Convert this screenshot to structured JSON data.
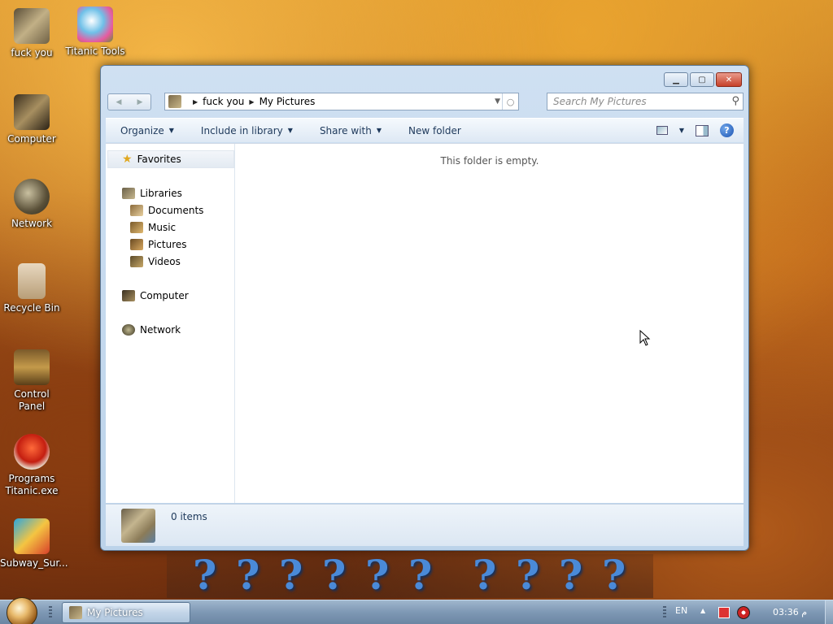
{
  "desktop": {
    "icons": [
      {
        "label": "fuck you",
        "icon": "library-folder-icon"
      },
      {
        "label": "Titanic Tools",
        "icon": "titanic-tools-icon"
      },
      {
        "label": "Computer",
        "icon": "computer-icon"
      },
      {
        "label": "Network",
        "icon": "network-icon"
      },
      {
        "label": "Recycle Bin",
        "icon": "recycle-bin-icon"
      },
      {
        "label": "Control Panel",
        "icon": "control-panel-icon"
      },
      {
        "label": "Programs Titanic.exe",
        "icon": "programs-icon"
      },
      {
        "label": "Subway_Sur...",
        "icon": "subway-surfers-icon"
      }
    ]
  },
  "window": {
    "controls": {
      "minimize": "minimize-icon",
      "maximize": "maximize-icon",
      "close": "close-icon"
    },
    "nav": {
      "back": "back-arrow-icon",
      "forward": "forward-arrow-icon"
    },
    "address": {
      "crumbs": [
        "fuck you",
        "My Pictures"
      ]
    },
    "search": {
      "placeholder": "Search My Pictures"
    },
    "toolbar": {
      "organize": "Organize",
      "include_in_library": "Include in library",
      "share_with": "Share with",
      "new_folder": "New folder"
    },
    "nav_pane": {
      "favorites": "Favorites",
      "libraries": "Libraries",
      "library_items": [
        "Documents",
        "Music",
        "Pictures",
        "Videos"
      ],
      "computer": "Computer",
      "network": "Network"
    },
    "main": {
      "empty_message": "This folder is empty."
    },
    "details": {
      "item_count": "0 items"
    }
  },
  "question_bar": {
    "mark": "?"
  },
  "taskbar": {
    "active_window": "My Pictures",
    "language": "EN",
    "clock": "03:36 م"
  }
}
